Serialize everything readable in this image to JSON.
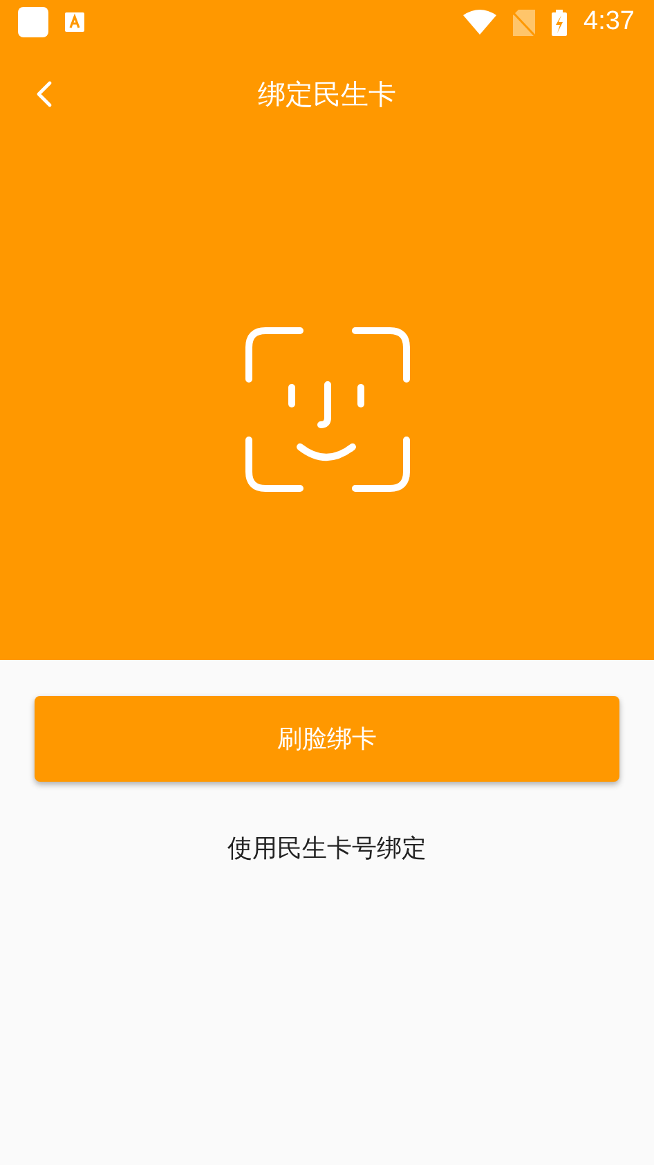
{
  "status_bar": {
    "time": "4:37"
  },
  "header": {
    "title": "绑定民生卡"
  },
  "primary_button": {
    "label": "刷脸绑卡"
  },
  "secondary_link": {
    "label": "使用民生卡号绑定"
  }
}
